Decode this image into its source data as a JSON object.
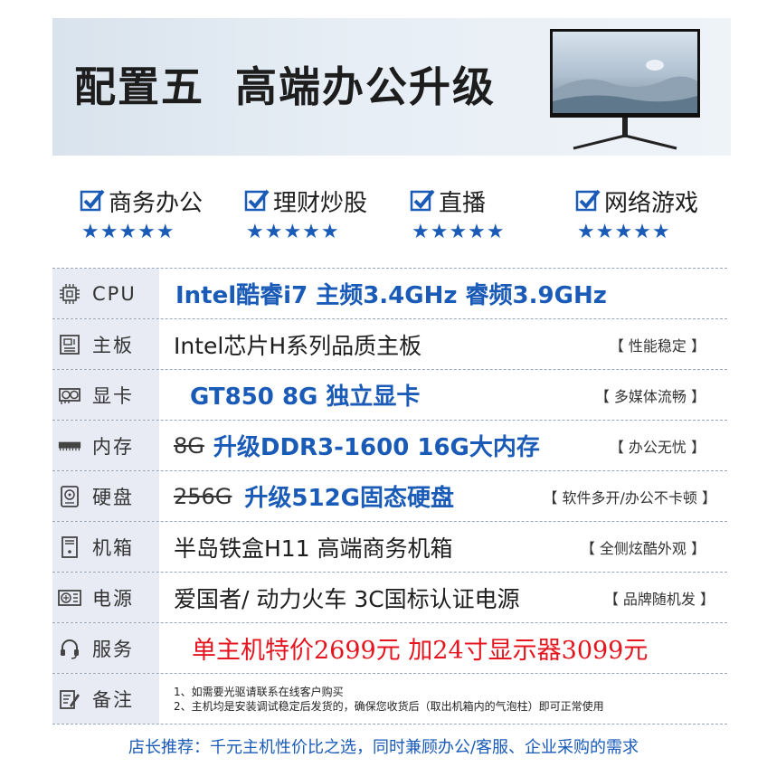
{
  "banner": {
    "title_a": "配置五",
    "title_b": "高端办公升级"
  },
  "features": [
    {
      "label": "商务办公",
      "stars": "★★★★★"
    },
    {
      "label": "理财炒股",
      "stars": "★★★★★"
    },
    {
      "label": "直播",
      "stars": "★★★★★"
    },
    {
      "label": "网络游戏",
      "stars": "★★★★★"
    }
  ],
  "rows": {
    "cpu": {
      "label": "CPU",
      "value": "Intel酷睿i7 主频3.4GHz 睿频3.9GHz"
    },
    "board": {
      "label": "主板",
      "value": "Intel芯片H系列品质主板",
      "tag": "【 性能稳定 】"
    },
    "gpu": {
      "label": "显卡",
      "value": "GT850 8G 独立显卡",
      "tag": "【 多媒体流畅 】"
    },
    "ram": {
      "label": "内存",
      "old": "8G",
      "value": "升级DDR3-1600 16G大内存",
      "tag": "【 办公无忧 】"
    },
    "disk": {
      "label": "硬盘",
      "old": "256G",
      "value": "升级512G固态硬盘",
      "tag": "【 软件多开/办公不卡顿 】"
    },
    "case": {
      "label": "机箱",
      "value": "半岛铁盒H11 高端商务机箱",
      "tag": "【 全侧炫酷外观 】"
    },
    "psu": {
      "label": "电源",
      "value": "爱国者/ 动力火车 3C国标认证电源",
      "tag": "【 品牌随机发 】"
    },
    "service": {
      "label": "服务",
      "value": "单主机特价2699元 加24寸显示器3099元"
    },
    "note": {
      "label": "备注",
      "line1": "1、如需要光驱请联系在线客户购买",
      "line2": "2、主机均是安装调试稳定后发货的，确保您收货后（取出机箱内的气泡柱）即可正常使用"
    }
  },
  "footer": "店长推荐：千元主机性价比之选，同时兼顾办公/客服、企业采购的需求",
  "colors": {
    "accent": "#1a5bb8",
    "price": "#e4151f",
    "label_bg": "#e8ebf4"
  }
}
